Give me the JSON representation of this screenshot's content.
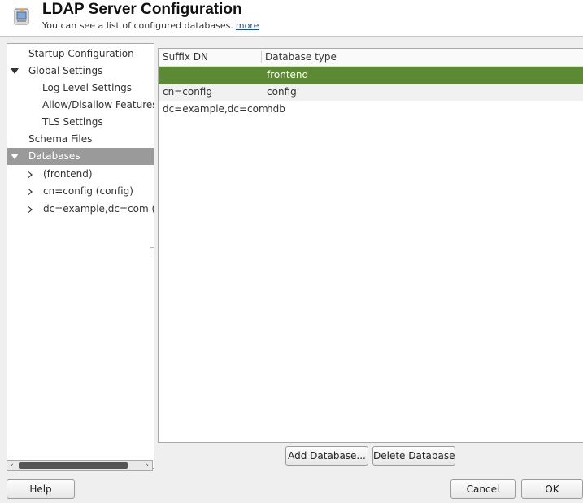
{
  "header": {
    "title": "LDAP Server Configuration",
    "subtitle": "You can see a list of configured databases.",
    "more_link": "more"
  },
  "tree": {
    "items": [
      {
        "label": "Startup Configuration"
      },
      {
        "label": "Global Settings"
      },
      {
        "label": "Log Level Settings"
      },
      {
        "label": "Allow/Disallow Features"
      },
      {
        "label": "TLS Settings"
      },
      {
        "label": "Schema Files"
      },
      {
        "label": "Databases"
      },
      {
        "label": "(frontend)"
      },
      {
        "label": "cn=config (config)"
      },
      {
        "label": "dc=example,dc=com (h"
      }
    ]
  },
  "table": {
    "headers": [
      "Suffix DN",
      "Database type"
    ],
    "rows": [
      {
        "suffix": "",
        "type": "frontend"
      },
      {
        "suffix": "cn=config",
        "type": "config"
      },
      {
        "suffix": "dc=example,dc=com",
        "type": "hdb"
      }
    ]
  },
  "buttons": {
    "add_database": "Add Database...",
    "delete_database": "Delete Database",
    "help": "Help",
    "cancel": "Cancel",
    "ok": "OK"
  },
  "colors": {
    "selected_row": "#5c8a34",
    "selected_tree": "#9a9a9a",
    "link": "#1a4ea0"
  }
}
